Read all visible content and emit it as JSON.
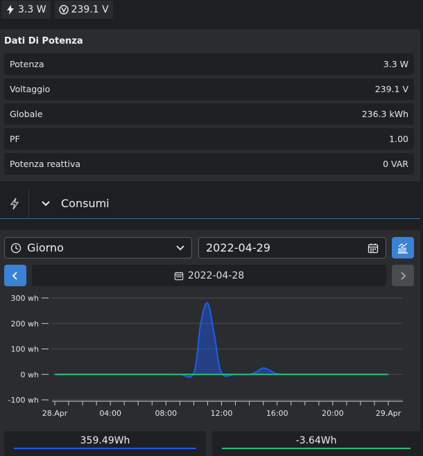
{
  "top": {
    "power": "3.3 W",
    "voltage": "239.1 V"
  },
  "panel": {
    "title": "Dati Di Potenza",
    "rows": [
      {
        "label": "Potenza",
        "value": "3.3 W"
      },
      {
        "label": "Voltaggio",
        "value": "239.1 V"
      },
      {
        "label": "Globale",
        "value": "236.3 kWh"
      },
      {
        "label": "PF",
        "value": "1.00"
      },
      {
        "label": "Potenza reattiva",
        "value": "0 VAR"
      }
    ]
  },
  "section": {
    "title": "Consumi"
  },
  "controls": {
    "period": "Giorno",
    "date": "2022-04-29",
    "nav_date": "2022-04-28"
  },
  "colors": {
    "accent": "#3b82d6",
    "series1": "#1e5bf0",
    "series2": "#27c07a"
  },
  "chart_data": {
    "type": "area",
    "yticks": [
      "300 wh",
      "200 wh",
      "100 wh",
      "0 wh",
      "-100 wh"
    ],
    "ylim": [
      -100,
      300
    ],
    "xticks": [
      "28.Apr",
      "04:00",
      "08:00",
      "12:00",
      "16:00",
      "20:00",
      "29.Apr"
    ],
    "series": [
      {
        "x": [
          "00:00",
          "01:00",
          "02:00",
          "03:00",
          "04:00",
          "05:00",
          "06:00",
          "07:00",
          "08:00",
          "09:00",
          "10:00",
          "10:30",
          "11:00",
          "11:30",
          "12:00",
          "13:00",
          "14:00",
          "14:30",
          "15:00",
          "15:30",
          "16:00",
          "17:00",
          "18:00",
          "19:00",
          "20:00",
          "21:00",
          "22:00",
          "23:00",
          "24:00"
        ],
        "values": [
          0,
          0,
          0,
          0,
          0,
          0,
          0,
          0,
          0,
          0,
          5,
          200,
          280,
          150,
          5,
          0,
          0,
          10,
          25,
          15,
          2,
          0,
          0,
          0,
          0,
          0,
          0,
          0,
          0
        ]
      },
      {
        "x": [
          "00:00",
          "24:00"
        ],
        "values": [
          0,
          0
        ]
      }
    ],
    "totals": [
      "359.49Wh",
      "-3.64Wh"
    ]
  }
}
